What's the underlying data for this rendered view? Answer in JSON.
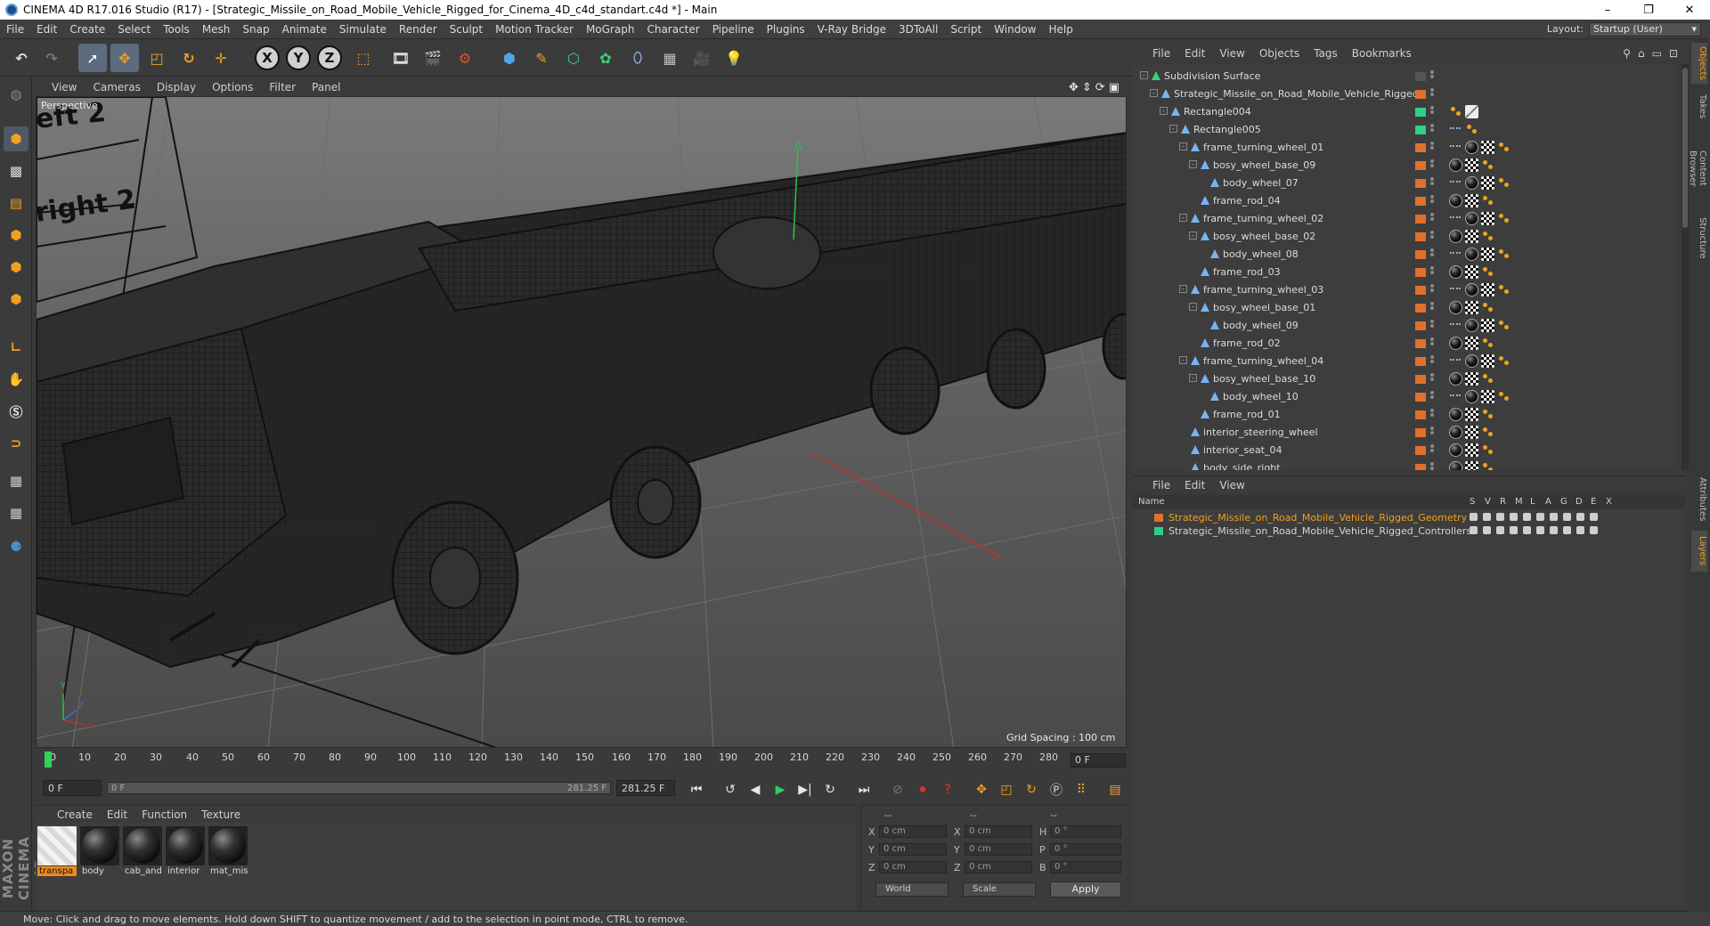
{
  "titlebar": {
    "title": "CINEMA 4D R17.016 Studio (R17) - [Strategic_Missile_on_Road_Mobile_Vehicle_Rigged_for_Cinema_4D_c4d_standart.c4d *] - Main",
    "minimize": "–",
    "maximize": "❐",
    "close": "✕"
  },
  "menubar": {
    "items": [
      "File",
      "Edit",
      "Create",
      "Select",
      "Tools",
      "Mesh",
      "Snap",
      "Animate",
      "Simulate",
      "Render",
      "Sculpt",
      "Motion Tracker",
      "MoGraph",
      "Character",
      "Pipeline",
      "Plugins",
      "V-Ray Bridge",
      "3DToAll",
      "Script",
      "Window",
      "Help"
    ],
    "layout_label": "Layout:",
    "layout_value": "Startup (User)"
  },
  "toolbar": {
    "axis_x": "X",
    "axis_y": "Y",
    "axis_z": "Z"
  },
  "viewport": {
    "menu": [
      "View",
      "Cameras",
      "Display",
      "Options",
      "Filter",
      "Panel"
    ],
    "label": "Perspective",
    "grid_spacing": "Grid Spacing : 100 cm",
    "overlay_text_1": "eft 2",
    "overlay_text_2": "right 2",
    "axis_y_label": "Y",
    "axis_z_label": "Z",
    "axis_x_label": "X"
  },
  "timeline": {
    "ticks": [
      "0",
      "10",
      "20",
      "30",
      "40",
      "50",
      "60",
      "70",
      "80",
      "90",
      "100",
      "110",
      "120",
      "130",
      "140",
      "150",
      "160",
      "170",
      "180",
      "190",
      "200",
      "210",
      "220",
      "230",
      "240",
      "250",
      "260",
      "270",
      "280"
    ],
    "current_frame": "0 F"
  },
  "transport": {
    "start_field": "0 F",
    "range_start": "0 F",
    "range_end": "281.25 F",
    "end_field": "281.25 F"
  },
  "materials": {
    "menu": [
      "Create",
      "Edit",
      "Function",
      "Texture"
    ],
    "items": [
      {
        "name": "transpa",
        "kind": "checker",
        "highlighted": true
      },
      {
        "name": "body",
        "kind": "sphere",
        "highlighted": false
      },
      {
        "name": "cab_and",
        "kind": "sphere",
        "highlighted": false
      },
      {
        "name": "interior",
        "kind": "sphere",
        "highlighted": false
      },
      {
        "name": "mat_mis",
        "kind": "sphere",
        "highlighted": false
      }
    ]
  },
  "coords": {
    "head1": "--",
    "head2": "--",
    "head3": "--",
    "rows": [
      {
        "l1": "X",
        "v1": "0 cm",
        "l2": "X",
        "v2": "0 cm",
        "l3": "H",
        "v3": "0 °"
      },
      {
        "l1": "Y",
        "v1": "0 cm",
        "l2": "Y",
        "v2": "0 cm",
        "l3": "P",
        "v3": "0 °"
      },
      {
        "l1": "Z",
        "v1": "0 cm",
        "l2": "Z",
        "v2": "0 cm",
        "l3": "B",
        "v3": "0 °"
      }
    ],
    "space": "World",
    "mode": "Scale",
    "apply": "Apply"
  },
  "statusbar": {
    "text": "Move: Click and drag to move elements. Hold down SHIFT to quantize movement / add to the selection in point mode, CTRL to remove."
  },
  "object_manager": {
    "menu": [
      "File",
      "Edit",
      "View",
      "Objects",
      "Tags",
      "Bookmarks"
    ],
    "rows": [
      {
        "name": "Subdivision Surface",
        "indent": 0,
        "expander": "-",
        "swatch": "#555555",
        "tags": []
      },
      {
        "name": "Strategic_Missile_on_Road_Mobile_Vehicle_Rigged",
        "indent": 1,
        "expander": "-",
        "swatch": "#e0702a",
        "tags": []
      },
      {
        "name": "Rectangle004",
        "indent": 2,
        "expander": "-",
        "swatch": "#2fd08a",
        "tags": [
          "orange",
          "white"
        ]
      },
      {
        "name": "Rectangle005",
        "indent": 3,
        "expander": "-",
        "swatch": "#2fd08a",
        "tags": [
          "blue",
          "orange"
        ]
      },
      {
        "name": "frame_turning_wheel_01",
        "indent": 4,
        "expander": "-",
        "swatch": "#e0702a",
        "tags": [
          "blue",
          "black",
          "check",
          "orange"
        ]
      },
      {
        "name": "bosy_wheel_base_09",
        "indent": 5,
        "expander": "-",
        "swatch": "#e0702a",
        "tags": [
          "black",
          "check",
          "orange"
        ]
      },
      {
        "name": "body_wheel_07",
        "indent": 6,
        "expander": "",
        "swatch": "#e0702a",
        "tags": [
          "blue",
          "black",
          "check",
          "orange"
        ]
      },
      {
        "name": "frame_rod_04",
        "indent": 5,
        "expander": "",
        "swatch": "#e0702a",
        "tags": [
          "black",
          "check",
          "orange"
        ]
      },
      {
        "name": "frame_turning_wheel_02",
        "indent": 4,
        "expander": "-",
        "swatch": "#e0702a",
        "tags": [
          "blue",
          "black",
          "check",
          "orange"
        ]
      },
      {
        "name": "bosy_wheel_base_02",
        "indent": 5,
        "expander": "-",
        "swatch": "#e0702a",
        "tags": [
          "black",
          "check",
          "orange"
        ]
      },
      {
        "name": "body_wheel_08",
        "indent": 6,
        "expander": "",
        "swatch": "#e0702a",
        "tags": [
          "blue",
          "black",
          "check",
          "orange"
        ]
      },
      {
        "name": "frame_rod_03",
        "indent": 5,
        "expander": "",
        "swatch": "#e0702a",
        "tags": [
          "black",
          "check",
          "orange"
        ]
      },
      {
        "name": "frame_turning_wheel_03",
        "indent": 4,
        "expander": "-",
        "swatch": "#e0702a",
        "tags": [
          "blue",
          "black",
          "check",
          "orange"
        ]
      },
      {
        "name": "bosy_wheel_base_01",
        "indent": 5,
        "expander": "-",
        "swatch": "#e0702a",
        "tags": [
          "black",
          "check",
          "orange"
        ]
      },
      {
        "name": "body_wheel_09",
        "indent": 6,
        "expander": "",
        "swatch": "#e0702a",
        "tags": [
          "blue",
          "black",
          "check",
          "orange"
        ]
      },
      {
        "name": "frame_rod_02",
        "indent": 5,
        "expander": "",
        "swatch": "#e0702a",
        "tags": [
          "black",
          "check",
          "orange"
        ]
      },
      {
        "name": "frame_turning_wheel_04",
        "indent": 4,
        "expander": "-",
        "swatch": "#e0702a",
        "tags": [
          "blue",
          "black",
          "check",
          "orange"
        ]
      },
      {
        "name": "bosy_wheel_base_10",
        "indent": 5,
        "expander": "-",
        "swatch": "#e0702a",
        "tags": [
          "black",
          "check",
          "orange"
        ]
      },
      {
        "name": "body_wheel_10",
        "indent": 6,
        "expander": "",
        "swatch": "#e0702a",
        "tags": [
          "blue",
          "black",
          "check",
          "orange"
        ]
      },
      {
        "name": "frame_rod_01",
        "indent": 5,
        "expander": "",
        "swatch": "#e0702a",
        "tags": [
          "black",
          "check",
          "orange"
        ]
      },
      {
        "name": "interior_steering_wheel",
        "indent": 4,
        "expander": "",
        "swatch": "#e0702a",
        "tags": [
          "black",
          "check",
          "orange"
        ]
      },
      {
        "name": "interior_seat_04",
        "indent": 4,
        "expander": "",
        "swatch": "#e0702a",
        "tags": [
          "black",
          "check",
          "orange"
        ]
      },
      {
        "name": "body_side_right",
        "indent": 4,
        "expander": "",
        "swatch": "#e0702a",
        "tags": [
          "black",
          "check",
          "orange"
        ]
      }
    ]
  },
  "layer_manager": {
    "menu": [
      "File",
      "Edit",
      "View"
    ],
    "header": {
      "name": "Name",
      "cols": [
        "S",
        "V",
        "R",
        "M",
        "L",
        "A",
        "G",
        "D",
        "E",
        "X"
      ]
    },
    "rows": [
      {
        "name": "Strategic_Missile_on_Road_Mobile_Vehicle_Rigged_Geometry",
        "color": "#e0702a",
        "text_color": "#f0a020"
      },
      {
        "name": "Strategic_Missile_on_Road_Mobile_Vehicle_Rigged_Controllers",
        "color": "#2fd08a",
        "text_color": "#d6d6d6"
      }
    ]
  },
  "side_tabs": [
    "Objects",
    "Takes",
    "Content Browser",
    "Structure",
    "Attributes",
    "Layers"
  ],
  "maxon_logo": "MAXON CINEMA 4D"
}
